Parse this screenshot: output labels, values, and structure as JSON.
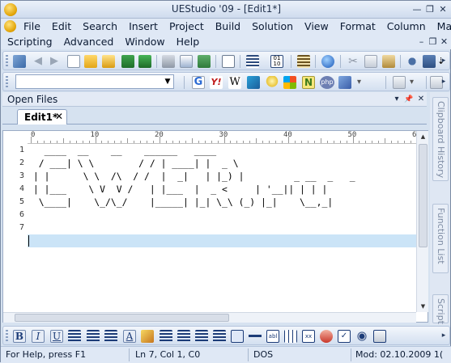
{
  "window": {
    "title": "UEStudio '09 - [Edit1*]",
    "controls": {
      "minimize": "—",
      "restore": "❐",
      "close": "✕"
    }
  },
  "menubar": {
    "row1": [
      "File",
      "Edit",
      "Search",
      "Insert",
      "Project",
      "Build",
      "Solution",
      "View",
      "Format",
      "Column",
      "Macro"
    ],
    "row2": [
      "Scripting",
      "Advanced",
      "Window",
      "Help"
    ],
    "mdi_controls": {
      "minimize": "–",
      "restore": "❐",
      "close": "✕"
    }
  },
  "toolbar1": {
    "icons": [
      "open-project-icon",
      "back-icon",
      "forward-icon",
      "new-file-icon",
      "open-folder-icon",
      "open-file-icon",
      "save-icon",
      "save-all-icon",
      "print-icon",
      "print-preview-icon",
      "excel-icon",
      "file-properties-icon",
      "word-wrap-icon",
      "hex-mode-icon",
      "line-numbers-icon",
      "web-browser-icon",
      "cut-icon",
      "copy-icon",
      "paste-icon",
      "find-icon",
      "replace-icon",
      "find-next-icon"
    ],
    "overflow": "▸"
  },
  "toolbar2": {
    "search_value": "",
    "icons": [
      "google-icon",
      "yahoo-icon",
      "wikipedia-icon",
      "dictionary-icon",
      "bulb-icon",
      "microsoft-icon",
      "n-icon",
      "php-icon",
      "jquery-icon",
      "chevron-icon",
      "clipboard-icon",
      "overflow-icon"
    ],
    "overflow": "▸"
  },
  "open_files": {
    "title": "Open Files",
    "controls": {
      "dropdown": "▾",
      "pin": "📌",
      "close": "✕"
    },
    "tabs": [
      {
        "label": "Edit1*",
        "close": "✕"
      }
    ]
  },
  "ruler": {
    "labels": [
      "0",
      "10",
      "20",
      "30",
      "40",
      "50",
      "6"
    ]
  },
  "editor": {
    "line_numbers": [
      "1",
      "2",
      "3",
      "4",
      "5",
      "6",
      "7"
    ],
    "lines": [
      "   ____  __    __    ______   ____",
      "  / ___| \\ \\        / / | ____| |  _ \\",
      " | |      \\ \\  /\\  / /  |  _|   | |_) |         _ __  _   _",
      " | |___    \\ V  V /   | |___  |  _ <     | '__|| | | |",
      "  \\____|    \\_/\\_/    |_____| |_| \\_\\ (_) |_|    \\__,_|",
      "",
      ""
    ],
    "current_line": 7
  },
  "right_dock": {
    "tabs": [
      "Clipboard History",
      "Function List",
      "Script"
    ]
  },
  "format_toolbar": {
    "icons": [
      "bold-icon",
      "italic-icon",
      "underline-icon",
      "indent-icon",
      "bullet-list-icon",
      "numbered-list-icon",
      "text-color-icon",
      "highlight-icon",
      "align-left-icon",
      "align-center-icon",
      "align-right-icon",
      "justify-icon",
      "insert-link-icon",
      "hr-icon",
      "abl-icon",
      "table-icon",
      "xx-icon",
      "special-icon",
      "checkbox-icon",
      "radio-icon",
      "button-icon"
    ],
    "overflow": "▸"
  },
  "statusbar": {
    "help": "For Help, press F1",
    "position": "Ln 7, Col 1, C0",
    "encoding": "DOS",
    "modified": "Mod: 02.10.2009 1("
  }
}
